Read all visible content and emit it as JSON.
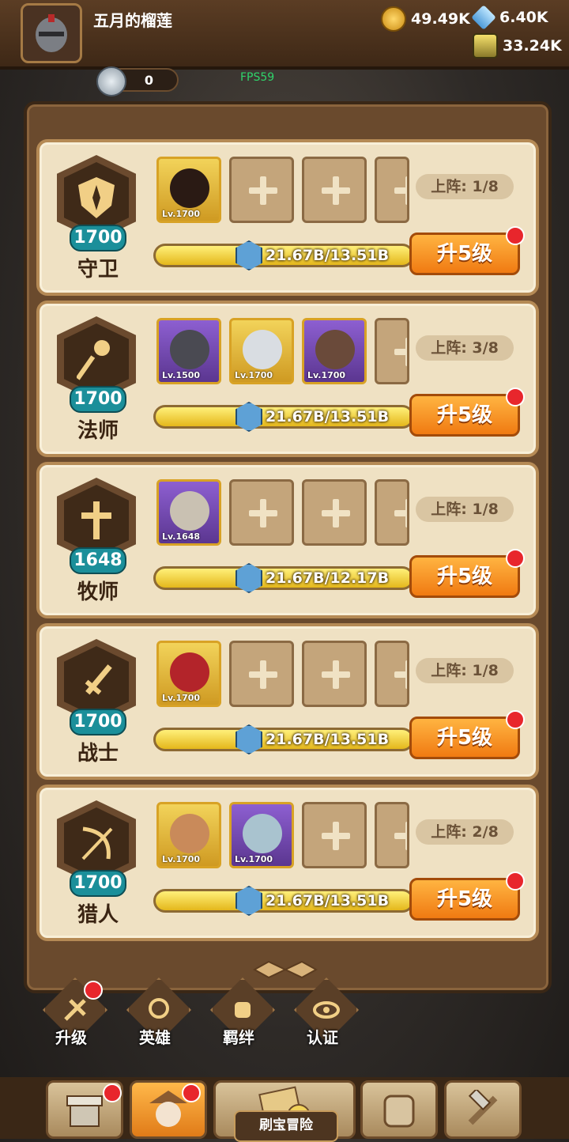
{
  "header": {
    "player_name": "五月的榴莲",
    "gold": "49.49K",
    "crystal": "6.40K",
    "potion": "33.24K",
    "silver": "0",
    "fps": "FPS59"
  },
  "classes": [
    {
      "name": "守卫",
      "level": "1700",
      "deploy": "上阵: 1/8",
      "exp": "21.67B/13.51B",
      "upgrade": "升5级",
      "heroes": [
        {
          "lv": "Lv.1700",
          "rarity": "gold"
        }
      ]
    },
    {
      "name": "法师",
      "level": "1700",
      "deploy": "上阵: 3/8",
      "exp": "21.67B/13.51B",
      "upgrade": "升5级",
      "heroes": [
        {
          "lv": "Lv.1500",
          "rarity": "purple"
        },
        {
          "lv": "Lv.1700",
          "rarity": "gold"
        },
        {
          "lv": "Lv.1700",
          "rarity": "purple"
        }
      ]
    },
    {
      "name": "牧师",
      "level": "1648",
      "deploy": "上阵: 1/8",
      "exp": "21.67B/12.17B",
      "upgrade": "升5级",
      "heroes": [
        {
          "lv": "Lv.1648",
          "rarity": "purple"
        }
      ]
    },
    {
      "name": "战士",
      "level": "1700",
      "deploy": "上阵: 1/8",
      "exp": "21.67B/13.51B",
      "upgrade": "升5级",
      "heroes": [
        {
          "lv": "Lv.1700",
          "rarity": "gold"
        }
      ]
    },
    {
      "name": "猎人",
      "level": "1700",
      "deploy": "上阵: 2/8",
      "exp": "21.67B/13.51B",
      "upgrade": "升5级",
      "heroes": [
        {
          "lv": "Lv.1700",
          "rarity": "gold"
        },
        {
          "lv": "Lv.1700",
          "rarity": "purple"
        }
      ]
    }
  ],
  "tabs": {
    "upgrade": "升级",
    "heroes": "英雄",
    "bonds": "羁绊",
    "certify": "认证"
  },
  "nav": {
    "adventure": "刷宝冒险"
  },
  "icons": {
    "classes": [
      "shield-icon",
      "staff-icon",
      "cross-icon",
      "sword-icon",
      "bow-icon"
    ]
  },
  "colors": {
    "accent_orange": "#f07a12",
    "badge_teal": "#1b8f9a",
    "notify_red": "#e8262c"
  }
}
